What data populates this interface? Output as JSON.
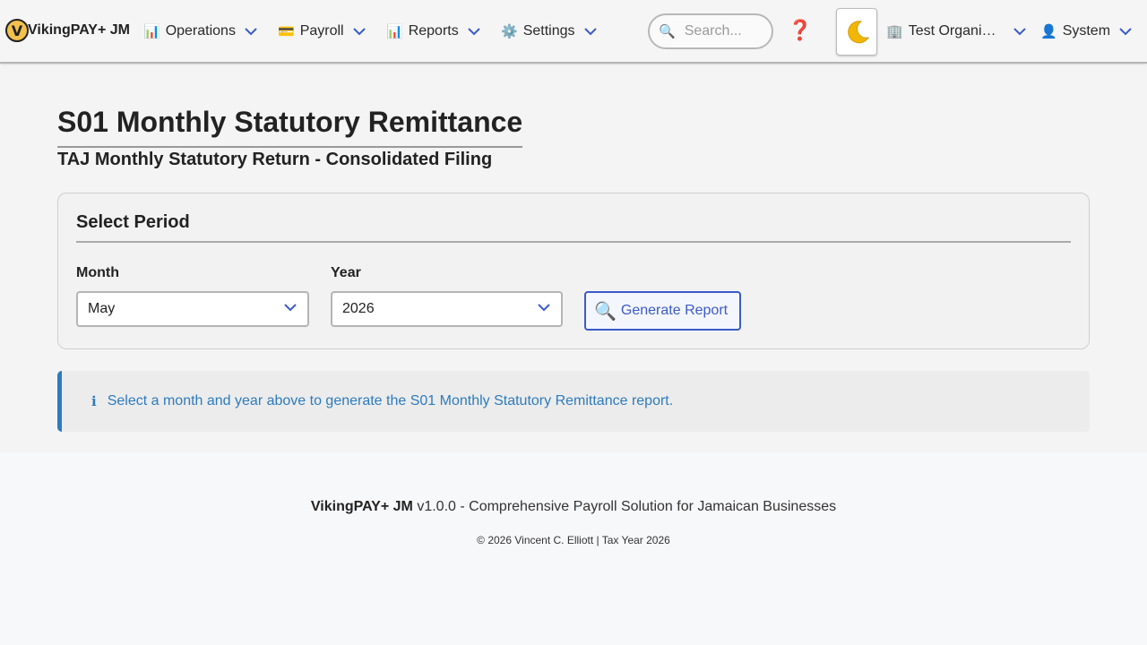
{
  "app": {
    "brand_logo_letter": "V",
    "brand_name": "VikingPAY+ JM"
  },
  "nav": {
    "operations": {
      "icon": "chart-icon",
      "emoji": "📊",
      "label": "Operations"
    },
    "payroll": {
      "icon": "credit-card-icon",
      "emoji": "💳",
      "label": "Payroll"
    },
    "reports": {
      "icon": "chart-icon",
      "emoji": "📊",
      "label": "Reports"
    },
    "settings": {
      "icon": "gear-icon",
      "emoji": "⚙️",
      "label": "Settings"
    },
    "search_placeholder": "Search...",
    "search_icon": "🔍",
    "help_icon": "❓",
    "theme_icon": "moon-icon",
    "organization": {
      "icon": "building-icon",
      "emoji": "🏢",
      "label": "Test Organi…"
    },
    "user": {
      "icon": "user-icon",
      "emoji": "👤",
      "label": "System"
    }
  },
  "page": {
    "title": "S01 Monthly Statutory Remittance",
    "subtitle": "TAJ Monthly Statutory Return - Consolidated Filing"
  },
  "period_card": {
    "title": "Select Period",
    "month_label": "Month",
    "month_value": "May",
    "year_label": "Year",
    "year_value": "2026",
    "generate_icon": "🔍",
    "generate_label": "Generate Report"
  },
  "alert": {
    "icon": "ℹ",
    "message": "Select a month and year above to generate the S01 Monthly Statutory Remittance report."
  },
  "footer": {
    "brand": "VikingPAY+ JM",
    "tagline": "v1.0.0 - Comprehensive Payroll Solution for Jamaican Businesses",
    "copyright": "© 2026 Vincent C. Elliott | Tax Year 2026"
  },
  "colors": {
    "accent": "#3a5bc7",
    "info": "#2e7bbd",
    "help": "#e03b3b"
  }
}
